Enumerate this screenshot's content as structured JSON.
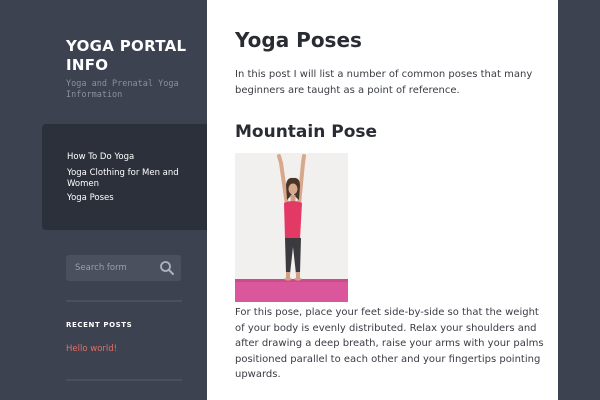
{
  "site": {
    "title": "YOGA PORTAL INFO",
    "description": "Yoga and Prenatal Yoga Information"
  },
  "nav": {
    "items": [
      {
        "label": "How To Do Yoga"
      },
      {
        "label": "Yoga Clothing for Men and Women"
      },
      {
        "label": "Yoga Poses"
      }
    ]
  },
  "search": {
    "placeholder": "Search form",
    "icon": "search-icon"
  },
  "recent_posts": {
    "title": "RECENT POSTS",
    "items": [
      {
        "label": "Hello world!"
      }
    ]
  },
  "post": {
    "title": "Yoga Poses",
    "intro": "In this post I will list a number of common poses that many beginners are taught as a point of reference.",
    "sections": [
      {
        "heading": "Mountain Pose",
        "description": "For this pose, place your feet side-by-side so that the weight of your body is evenly distributed. Relax your shoulders and after drawing a deep breath, raise your arms with your palms positioned parallel to each other and your fingertips pointing upwards."
      }
    ]
  },
  "colors": {
    "sidebar_bg": "#3d4250",
    "nav_panel_bg": "#2b303a",
    "link_accent": "#e0706a",
    "content_bg": "#ffffff"
  }
}
